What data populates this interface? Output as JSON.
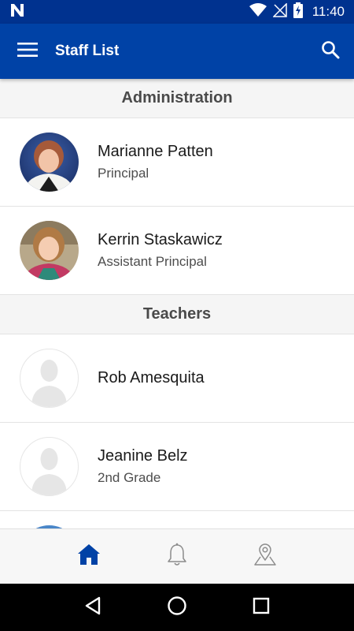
{
  "status_bar": {
    "time": "11:40",
    "icons": [
      "n-logo-icon",
      "wifi-icon",
      "no-signal-icon",
      "battery-charging-icon"
    ]
  },
  "app_bar": {
    "title": "Staff List",
    "menu_icon": "menu-icon",
    "search_icon": "search-icon",
    "background": "#0042a6"
  },
  "sections": [
    {
      "title": "Administration",
      "staff": [
        {
          "name": "Marianne Patten",
          "role": "Principal",
          "avatar": "photo"
        },
        {
          "name": "Kerrin Staskawicz",
          "role": "Assistant Principal",
          "avatar": "photo"
        }
      ]
    },
    {
      "title": "Teachers",
      "staff": [
        {
          "name": "Rob Amesquita",
          "role": "",
          "avatar": "placeholder"
        },
        {
          "name": "Jeanine Belz",
          "role": "2nd Grade",
          "avatar": "placeholder"
        }
      ]
    }
  ],
  "bottom_nav": {
    "items": [
      {
        "icon": "home-icon",
        "active": true
      },
      {
        "icon": "bell-icon",
        "active": false
      },
      {
        "icon": "map-pin-icon",
        "active": false
      }
    ],
    "active_color": "#0042a6",
    "inactive_color": "#8c8c8c"
  },
  "system_nav": {
    "icons": [
      "back-icon",
      "home-circle-icon",
      "recents-icon"
    ]
  }
}
